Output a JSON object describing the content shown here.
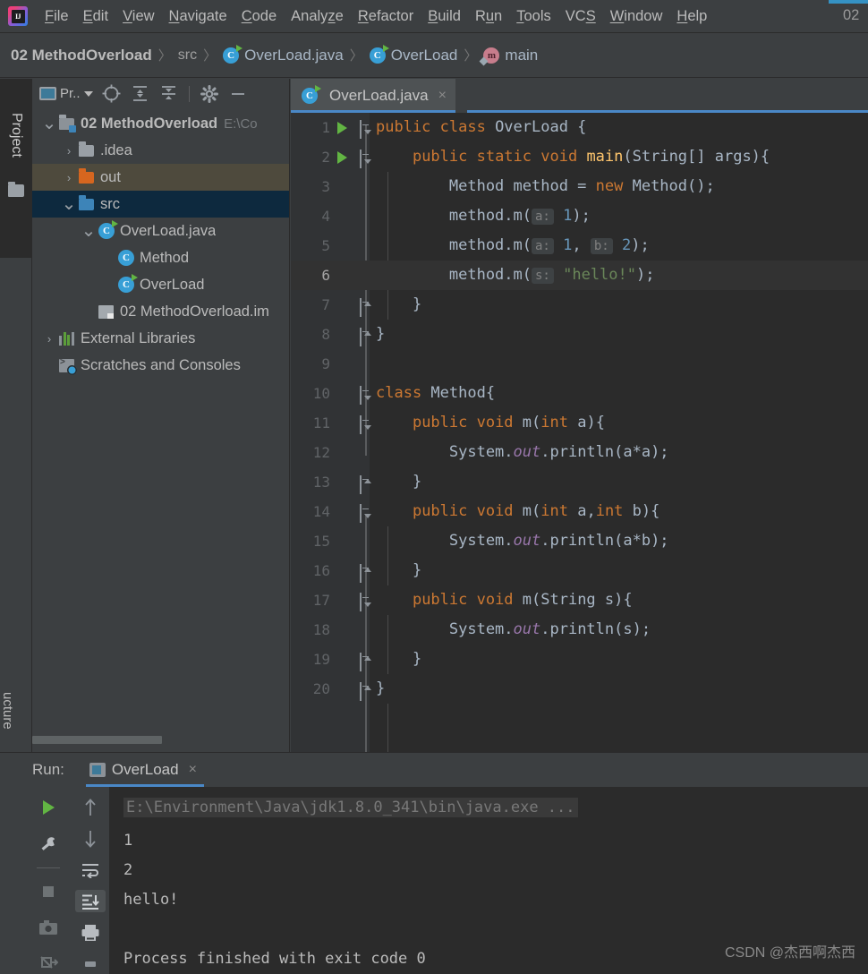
{
  "window": {
    "menu_items": [
      {
        "label": "File",
        "mnemonic": "F"
      },
      {
        "label": "Edit",
        "mnemonic": "E"
      },
      {
        "label": "View",
        "mnemonic": "V"
      },
      {
        "label": "Navigate",
        "mnemonic": "N"
      },
      {
        "label": "Code",
        "mnemonic": "C"
      },
      {
        "label": "Analyze",
        "mnemonic": "z"
      },
      {
        "label": "Refactor",
        "mnemonic": "R"
      },
      {
        "label": "Build",
        "mnemonic": "B"
      },
      {
        "label": "Run",
        "mnemonic": "u"
      },
      {
        "label": "Tools",
        "mnemonic": "T"
      },
      {
        "label": "VCS",
        "mnemonic": "S"
      },
      {
        "label": "Window",
        "mnemonic": "W"
      },
      {
        "label": "Help",
        "mnemonic": "H"
      }
    ],
    "right_truncated_label": "02"
  },
  "breadcrumb": [
    {
      "label": "02 MethodOverload",
      "icon": "none",
      "bold": true
    },
    {
      "label": "src",
      "icon": "none",
      "bold": false
    },
    {
      "label": "OverLoad.java",
      "icon": "class-runnable",
      "bold": false
    },
    {
      "label": "OverLoad",
      "icon": "class-runnable",
      "bold": false
    },
    {
      "label": "main",
      "icon": "method",
      "bold": false
    }
  ],
  "toolstrip": {
    "project_tab_label": "Project",
    "structure_tab_label": "ucture"
  },
  "project_panel": {
    "selector_label": "Pr..",
    "toolbar_icons": [
      "locate-icon",
      "expand-all-icon",
      "collapse-all-icon",
      "gear-icon",
      "minimize-icon"
    ],
    "tree": [
      {
        "label": "02 MethodOverload",
        "path": "E:\\Co",
        "icon": "folder-module",
        "arrow": "expanded",
        "indent": 0,
        "bold": true,
        "state": "normal"
      },
      {
        "label": ".idea",
        "path": "",
        "icon": "folder-gray",
        "arrow": "collapsed",
        "indent": 1,
        "bold": false,
        "state": "normal"
      },
      {
        "label": "out",
        "path": "",
        "icon": "folder-orange",
        "arrow": "collapsed",
        "indent": 1,
        "bold": false,
        "state": "hover"
      },
      {
        "label": "src",
        "path": "",
        "icon": "folder-blue",
        "arrow": "expanded",
        "indent": 1,
        "bold": false,
        "state": "selected"
      },
      {
        "label": "OverLoad.java",
        "path": "",
        "icon": "class-runnable",
        "arrow": "expanded",
        "indent": 2,
        "bold": false,
        "state": "normal"
      },
      {
        "label": "Method",
        "path": "",
        "icon": "class",
        "arrow": "none",
        "indent": 3,
        "bold": false,
        "state": "normal"
      },
      {
        "label": "OverLoad",
        "path": "",
        "icon": "class-runnable",
        "arrow": "none",
        "indent": 3,
        "bold": false,
        "state": "normal"
      },
      {
        "label": "02 MethodOverload.im",
        "path": "",
        "icon": "module-file",
        "arrow": "none",
        "indent": 2,
        "bold": false,
        "state": "normal"
      },
      {
        "label": "External Libraries",
        "path": "",
        "icon": "library",
        "arrow": "collapsed",
        "indent": 0,
        "bold": false,
        "state": "normal"
      },
      {
        "label": "Scratches and Consoles",
        "path": "",
        "icon": "scratch",
        "arrow": "none",
        "indent": 0,
        "bold": false,
        "state": "normal"
      }
    ]
  },
  "editor": {
    "tab": {
      "label": "OverLoad.java",
      "icon": "class-runnable",
      "close": "×"
    },
    "lines": [
      {
        "n": "1",
        "run": true,
        "fold": "open",
        "html": "<span class=\"kw\">public class</span> OverLoad {"
      },
      {
        "n": "2",
        "run": true,
        "fold": "open",
        "html": "    <span class=\"kw\">public static void</span> <span style=\"color:#FFC66D\">main</span>(String[] args){"
      },
      {
        "n": "3",
        "run": false,
        "fold": "none",
        "html": "        Method method = <span class=\"kw\">new</span> Method();"
      },
      {
        "n": "4",
        "run": false,
        "fold": "none",
        "html": "        method.m(<span class=\"hint\">a:</span> <span class=\"num\">1</span>);"
      },
      {
        "n": "5",
        "run": false,
        "fold": "none",
        "html": "        method.m(<span class=\"hint\">a:</span> <span class=\"num\">1</span>, <span class=\"hint\">b:</span> <span class=\"num\">2</span>);"
      },
      {
        "n": "6",
        "run": false,
        "fold": "none",
        "html": "        method.m(<span class=\"hint\">s:</span> <span class=\"str\">\"hello!\"</span>);",
        "highlight": true
      },
      {
        "n": "7",
        "run": false,
        "fold": "close",
        "html": "    }"
      },
      {
        "n": "8",
        "run": false,
        "fold": "close",
        "html": "}"
      },
      {
        "n": "9",
        "run": false,
        "fold": "none",
        "html": ""
      },
      {
        "n": "10",
        "run": false,
        "fold": "open",
        "html": "<span class=\"kw\">class</span> Method{"
      },
      {
        "n": "11",
        "run": false,
        "fold": "open",
        "html": "    <span class=\"kw\">public void</span> m(<span class=\"kw\">int</span> a){"
      },
      {
        "n": "12",
        "run": false,
        "fold": "none",
        "html": "        System.<span class=\"fld\">out</span>.println(a*a);"
      },
      {
        "n": "13",
        "run": false,
        "fold": "close",
        "html": "    }"
      },
      {
        "n": "14",
        "run": false,
        "fold": "open",
        "html": "    <span class=\"kw\">public void</span> m(<span class=\"kw\">int</span> a,<span class=\"kw\">int</span> b){"
      },
      {
        "n": "15",
        "run": false,
        "fold": "none",
        "html": "        System.<span class=\"fld\">out</span>.println(a*b);"
      },
      {
        "n": "16",
        "run": false,
        "fold": "close",
        "html": "    }"
      },
      {
        "n": "17",
        "run": false,
        "fold": "open",
        "html": "    <span class=\"kw\">public void</span> m(String s){"
      },
      {
        "n": "18",
        "run": false,
        "fold": "none",
        "html": "        System.<span class=\"fld\">out</span>.println(s);"
      },
      {
        "n": "19",
        "run": false,
        "fold": "close",
        "html": "    }"
      },
      {
        "n": "20",
        "run": false,
        "fold": "close",
        "html": "}"
      }
    ],
    "intention_bulb": "lightbulb-icon"
  },
  "run_panel": {
    "title": "Run:",
    "tab_label": "OverLoad",
    "tab_close": "×",
    "left_icons": [
      "rerun-icon",
      "wrench-icon",
      "stop-icon",
      "camera-icon",
      "debug-icon"
    ],
    "right_icons": [
      "arrow-up-icon",
      "arrow-down-icon",
      "soft-wrap-icon",
      "scroll-to-end-icon",
      "print-icon"
    ],
    "console": {
      "command": "E:\\Environment\\Java\\jdk1.8.0_341\\bin\\java.exe ...",
      "output": [
        "1",
        "2",
        "hello!",
        "",
        "Process finished with exit code 0"
      ]
    },
    "watermark": "CSDN @杰西啊杰西"
  },
  "colors": {
    "accent_blue": "#4A88C7",
    "keyword_orange": "#CC7832",
    "string_green": "#6A8759",
    "number_blue": "#6897BB",
    "field_purple": "#9876AA",
    "method_yellow": "#FFC66D",
    "selection_blue": "#0D293E",
    "hover_brown": "#4E4A3D",
    "editor_bg": "#2B2B2B",
    "panel_bg": "#3C3F41"
  }
}
